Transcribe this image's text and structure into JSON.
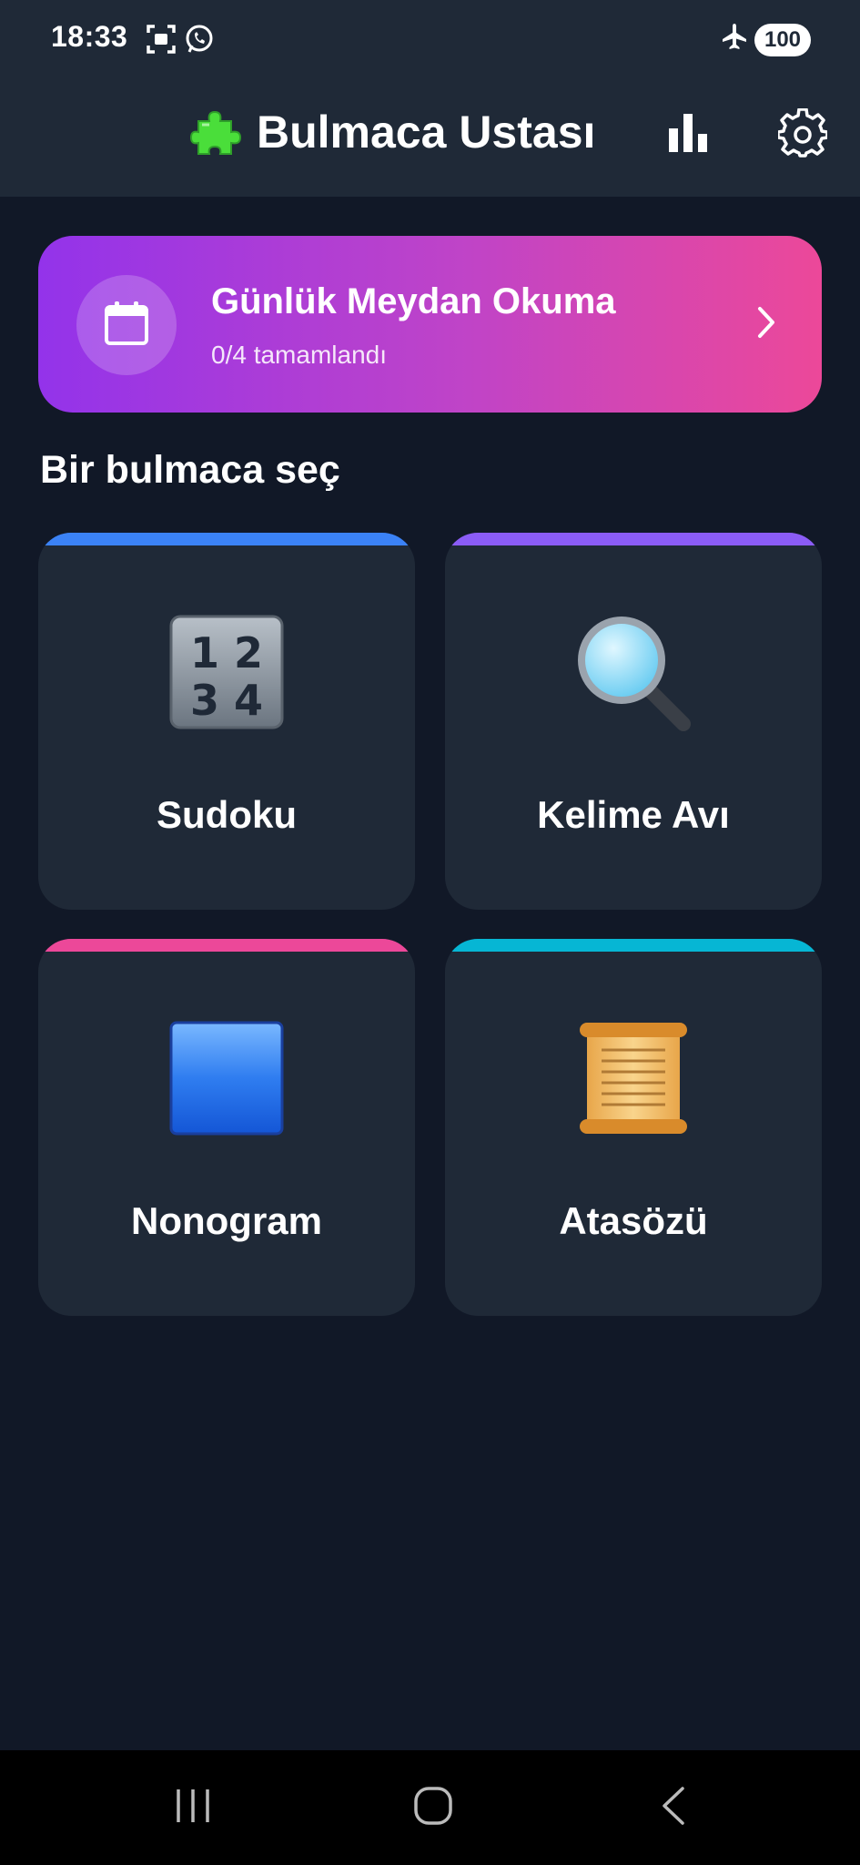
{
  "status_bar": {
    "time": "18:33",
    "battery": "100",
    "icons": [
      "screenshot-icon",
      "whatsapp-icon",
      "airplane-mode-icon"
    ]
  },
  "app_bar": {
    "title": "Bulmaca Ustası",
    "title_icon": "puzzle-icon",
    "actions": [
      "stats-icon",
      "settings-icon"
    ]
  },
  "daily_challenge": {
    "title": "Günlük Meydan Okuma",
    "progress": "0/4 tamamlandı",
    "icon": "calendar-icon",
    "gradient": [
      "#9333ea",
      "#ec4899"
    ]
  },
  "section_title": "Bir bulmaca seç",
  "puzzles": [
    {
      "label": "Sudoku",
      "accent": "#3b82f6",
      "icon": "numbers-1234-icon"
    },
    {
      "label": "Kelime Avı",
      "accent": "#8b5cf6",
      "icon": "magnifier-icon"
    },
    {
      "label": "Nonogram",
      "accent": "#ec4899",
      "icon": "blue-square-icon"
    },
    {
      "label": "Atasözü",
      "accent": "#06b6d4",
      "icon": "scroll-icon"
    }
  ],
  "nav_bar": [
    "recent-apps-icon",
    "home-icon",
    "back-icon"
  ],
  "colors": {
    "background": "#111827",
    "surface": "#1f2937"
  }
}
